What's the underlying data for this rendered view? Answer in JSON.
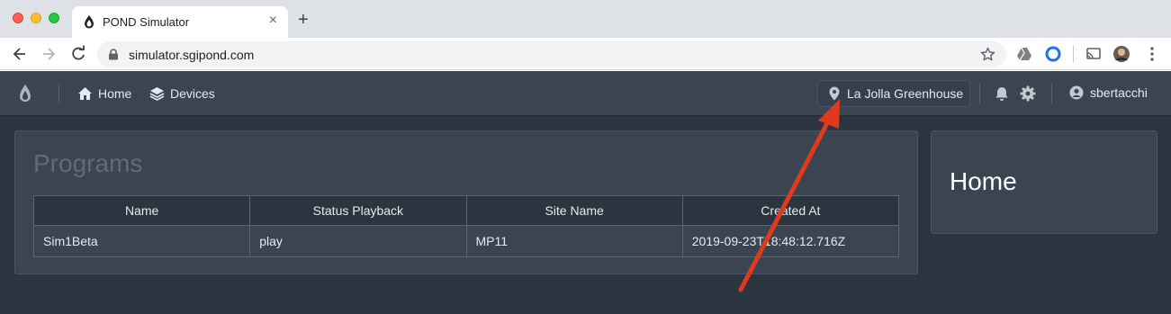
{
  "browser": {
    "tab_title": "POND Simulator",
    "tab_close": "×",
    "new_tab": "+",
    "url": "simulator.sgipond.com"
  },
  "appbar": {
    "nav": [
      {
        "label": "Home",
        "icon": "home-icon"
      },
      {
        "label": "Devices",
        "icon": "layers-icon"
      }
    ],
    "location": "La Jolla Greenhouse",
    "user": "sbertacchi"
  },
  "programs": {
    "title": "Programs",
    "columns": [
      "Name",
      "Status Playback",
      "Site Name",
      "Created At"
    ],
    "rows": [
      [
        "Sim1Beta",
        "play",
        "MP11",
        "2019-09-23T18:48:12.716Z"
      ]
    ]
  },
  "home_panel": {
    "title": "Home"
  },
  "colors": {
    "app_background": "#2c3440",
    "panel_background": "#3b4552",
    "annotation_arrow": "#e03a1e"
  }
}
